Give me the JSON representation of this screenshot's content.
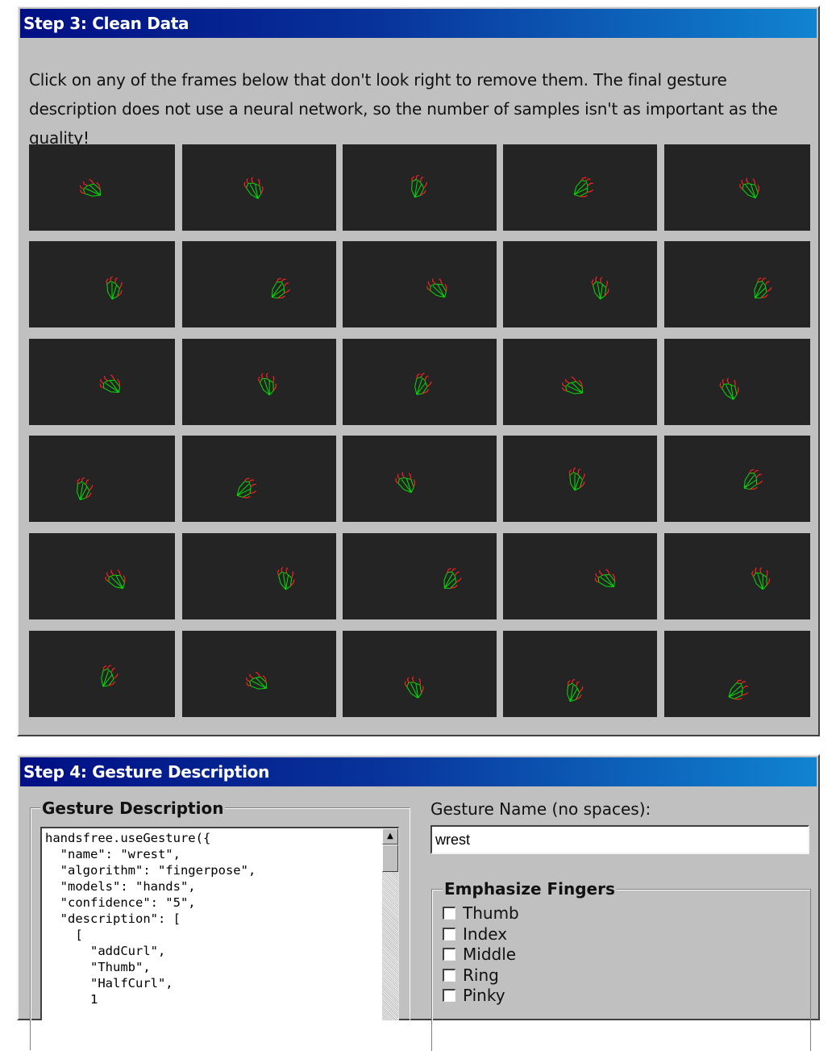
{
  "step3": {
    "title": "Step 3: Clean Data",
    "instructions": "Click on any of the frames below that don't look right to remove them. The final gesture description does not use a neural network, so the number of samples isn't as important as the quality!"
  },
  "frames": {
    "count": 30,
    "background": "#242424",
    "skeleton_colors": {
      "bones": "#00e000",
      "joints": "#ff2020"
    }
  },
  "step4": {
    "title": "Step 4: Gesture Description",
    "description_legend": "Gesture Description",
    "description_code": "handsfree.useGesture({\n  \"name\": \"wrest\",\n  \"algorithm\": \"fingerpose\",\n  \"models\": \"hands\",\n  \"confidence\": \"5\",\n  \"description\": [\n    [\n      \"addCurl\",\n      \"Thumb\",\n      \"HalfCurl\",\n      1",
    "name_label": "Gesture Name (no spaces):",
    "name_value": "wrest",
    "emphasize_legend": "Emphasize Fingers",
    "fingers": [
      "Thumb",
      "Index",
      "Middle",
      "Ring",
      "Pinky"
    ]
  },
  "theme": {
    "window_bg": "#c0c0c0",
    "titlebar_start": "#000f85",
    "titlebar_end": "#1084d0"
  }
}
